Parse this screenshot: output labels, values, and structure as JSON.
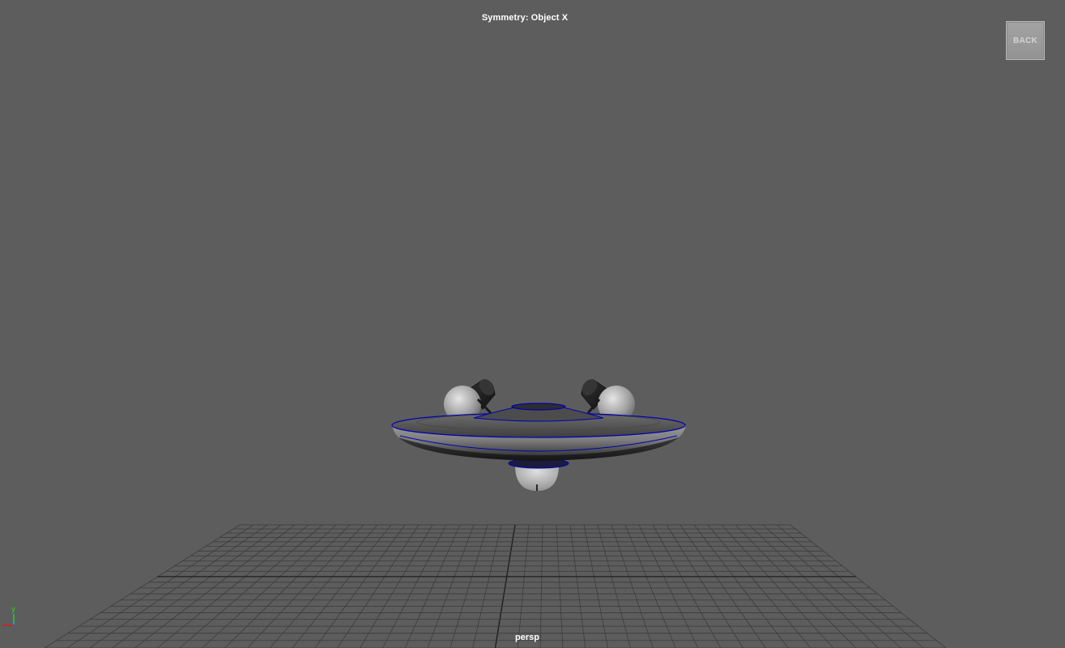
{
  "hud": {
    "symmetry_label": "Symmetry: Object X",
    "camera_label": "persp"
  },
  "controls": {
    "back_label": "BACK"
  },
  "axis_gizmo": {
    "y_label": "y",
    "icon": "axis-gizmo-icon"
  },
  "colors": {
    "viewport_bg": "#5d5d5d",
    "grid_line": "#3c3c3c",
    "grid_axis": "#1e1e1e",
    "edge_highlight": "#0000b4",
    "label_text": "#ffffff"
  }
}
